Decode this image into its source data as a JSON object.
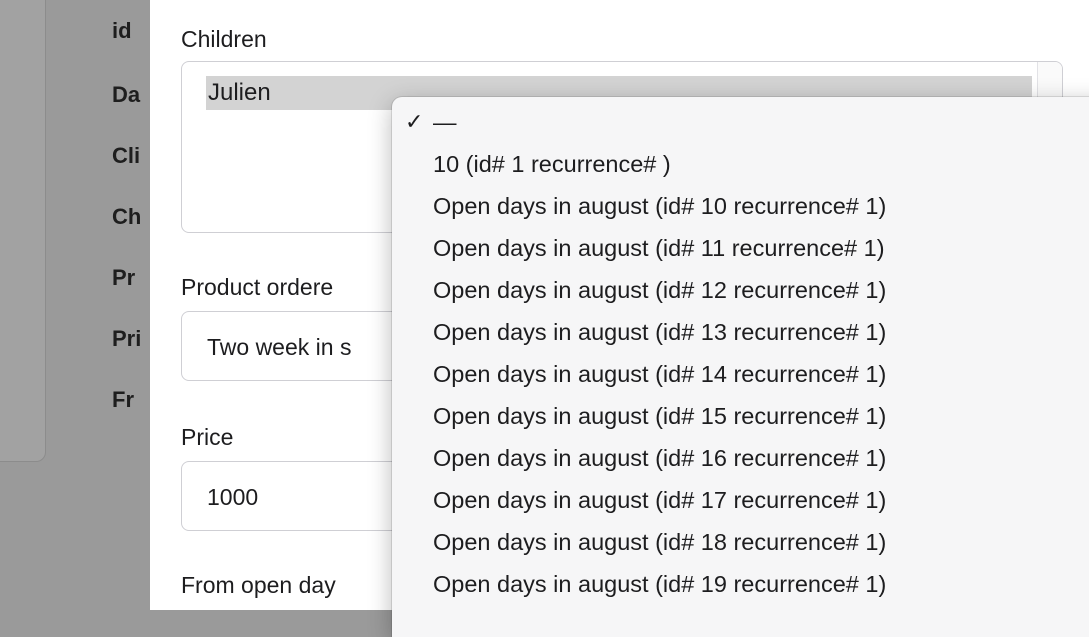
{
  "background": {
    "labels": [
      "id",
      "Da",
      "Cli",
      "Ch",
      "Pr",
      "Pri",
      "Fr"
    ]
  },
  "form": {
    "children_label": "Children",
    "children_selected": "Julien",
    "product_label": "Product ordere",
    "product_value": "Two week in s",
    "price_label": "Price",
    "price_value": "1000",
    "from_open_days_label": "From open day"
  },
  "dropdown": {
    "checkmark": "✓",
    "items": [
      "—",
      "10 (id# 1 recurrence# )",
      "Open days in august (id# 10 recurrence# 1)",
      "Open days in august (id# 11 recurrence# 1)",
      "Open days in august (id# 12 recurrence# 1)",
      "Open days in august (id# 13 recurrence# 1)",
      "Open days in august (id# 14 recurrence# 1)",
      "Open days in august (id# 15 recurrence# 1)",
      "Open days in august (id# 16 recurrence# 1)",
      "Open days in august (id# 17 recurrence# 1)",
      "Open days in august (id# 18 recurrence# 1)",
      "Open days in august (id# 19 recurrence# 1)"
    ]
  }
}
